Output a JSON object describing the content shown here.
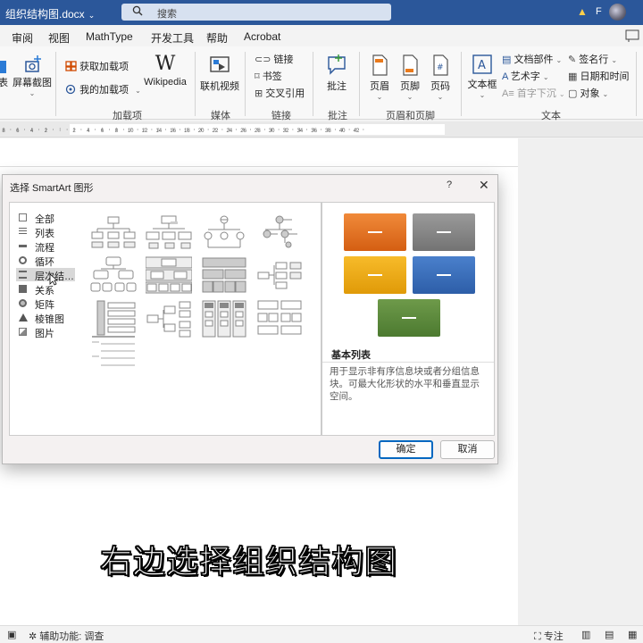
{
  "titlebar": {
    "doc_title": "组织结构图.docx",
    "search_placeholder": "搜索",
    "user_initial": "F"
  },
  "ribbon_tabs": [
    "审阅",
    "视图",
    "MathType",
    "开发工具",
    "帮助",
    "Acrobat"
  ],
  "ribbon": {
    "partial_left": "表",
    "screenshot": "屏幕截图",
    "get_addins": "获取加载项",
    "my_addins": "我的加载项",
    "wikipedia": "Wikipedia",
    "addins_group": "加载项",
    "online_video": "联机视频",
    "media_group": "媒体",
    "link": "链接",
    "bookmark": "书签",
    "cross_ref": "交叉引用",
    "links_group": "链接",
    "comment": "批注",
    "comments_group": "批注",
    "header": "页眉",
    "footer": "页脚",
    "page_number": "页码",
    "header_footer_group": "页眉和页脚",
    "textbox": "文本框",
    "quick_parts": "文档部件",
    "wordart": "艺术字",
    "dropcap": "首字下沉",
    "signature": "签名行",
    "datetime": "日期和时间",
    "object": "对象",
    "text_group": "文本"
  },
  "ruler": {
    "labels": [
      "8",
      "6",
      "4",
      "2",
      "",
      "2",
      "4",
      "6",
      "8",
      "10",
      "12",
      "14",
      "16",
      "18",
      "20",
      "22",
      "24",
      "26",
      "28",
      "30",
      "32",
      "34",
      "36",
      "38",
      "40",
      "42"
    ]
  },
  "dialog": {
    "title": "选择 SmartArt 图形",
    "help": "?",
    "close": "✕",
    "categories": [
      {
        "label": "全部",
        "icon": "all-icon"
      },
      {
        "label": "列表",
        "icon": "list-icon"
      },
      {
        "label": "流程",
        "icon": "process-icon"
      },
      {
        "label": "循环",
        "icon": "cycle-icon"
      },
      {
        "label": "层次结…",
        "icon": "hierarchy-icon",
        "selected": true
      },
      {
        "label": "关系",
        "icon": "relationship-icon"
      },
      {
        "label": "矩阵",
        "icon": "matrix-icon"
      },
      {
        "label": "棱锥图",
        "icon": "pyramid-icon"
      },
      {
        "label": "图片",
        "icon": "picture-icon"
      }
    ],
    "preview": {
      "name": "基本列表",
      "description": "用于显示非有序信息块或者分组信息块。可最大化形状的水平和垂直显示空间。",
      "colors": [
        "#e4701e",
        "#8a8a8a",
        "#f0a814",
        "#3a6fbf",
        "#5c8a3c"
      ]
    },
    "ok": "确定",
    "cancel": "取消"
  },
  "subtitle": "右边选择组织结构图",
  "statusbar": {
    "accessibility": "辅助功能: 调查",
    "focus": "专注"
  }
}
